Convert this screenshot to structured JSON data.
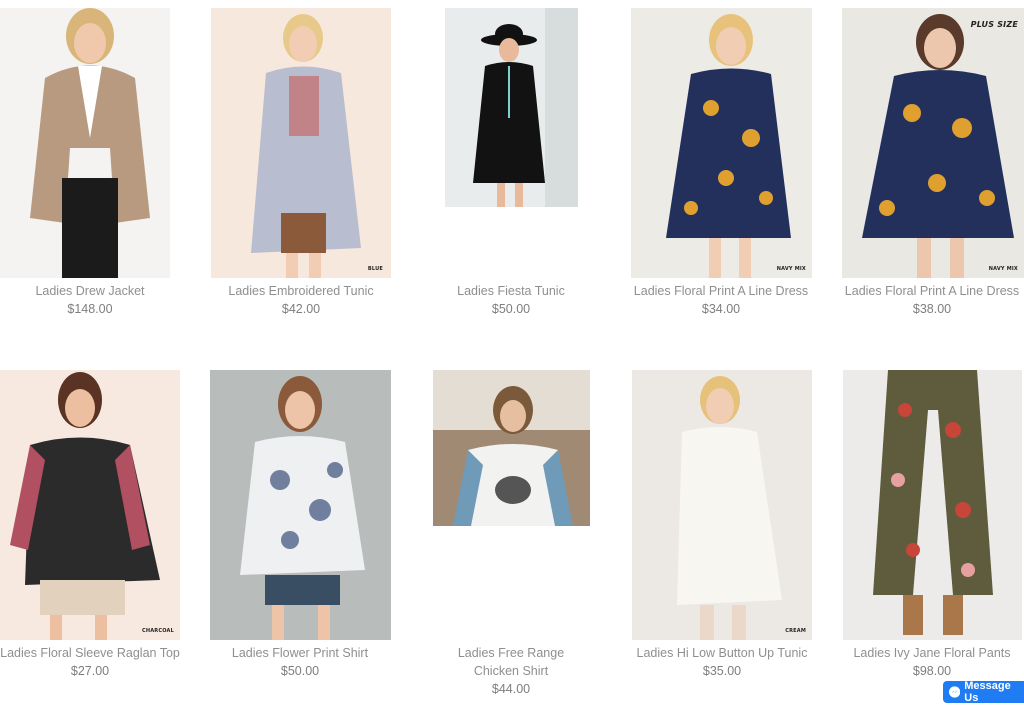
{
  "products": [
    {
      "name": "Ladies Drew Jacket",
      "price": "$148.00",
      "tag": ""
    },
    {
      "name": "Ladies Embroidered Tunic",
      "price": "$42.00",
      "tag": "BLUE"
    },
    {
      "name": "Ladies Fiesta Tunic",
      "price": "$50.00",
      "tag": ""
    },
    {
      "name": "Ladies Floral Print A Line Dress",
      "price": "$34.00",
      "tag": "NAVY MIX"
    },
    {
      "name": "Ladies Floral Print A Line Dress",
      "price": "$38.00",
      "tag": "NAVY MIX",
      "badge": "PLUS SIZE"
    },
    {
      "name": "Ladies Floral Sleeve Raglan Top",
      "price": "$27.00",
      "tag": "CHARCOAL"
    },
    {
      "name": "Ladies Flower Print Shirt",
      "price": "$50.00",
      "tag": ""
    },
    {
      "name": "Ladies Free Range Chicken Shirt",
      "price": "$44.00",
      "tag": ""
    },
    {
      "name": "Ladies Hi Low Button Up Tunic",
      "price": "$35.00",
      "tag": "CREAM"
    },
    {
      "name": "Ladies Ivy Jane Floral Pants",
      "price": "$98.00",
      "tag": ""
    }
  ],
  "messenger": {
    "label": "Message Us",
    "icon": "messenger-icon"
  }
}
